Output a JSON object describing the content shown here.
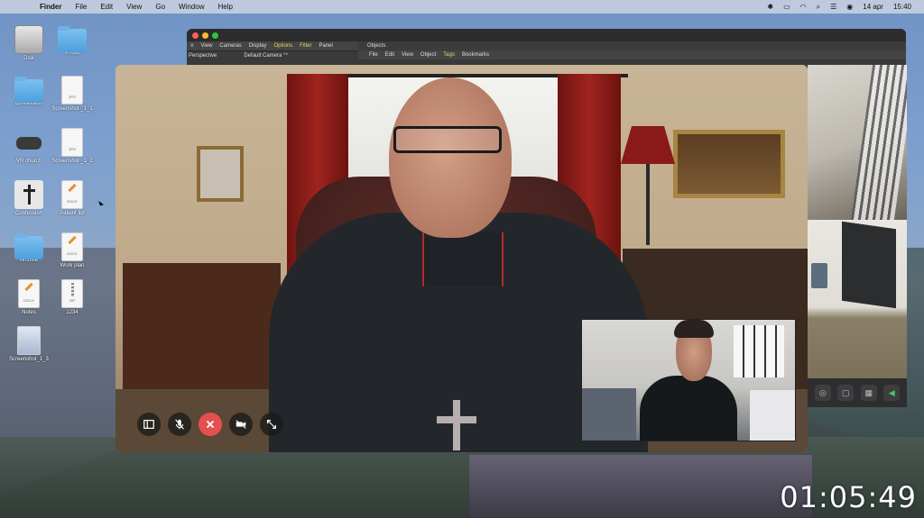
{
  "menubar": {
    "app": "Finder",
    "items": [
      "File",
      "Edit",
      "View",
      "Go",
      "Window",
      "Help"
    ],
    "date": "14 apr",
    "time": "15:40"
  },
  "desktop": {
    "icons": [
      {
        "label": "Disk",
        "type": "disk"
      },
      {
        "label": "Photo",
        "type": "folder"
      },
      {
        "label": "Confession",
        "type": "folder"
      },
      {
        "label": "Screenshot _1_1",
        "type": "doc",
        "tag": "JPG"
      },
      {
        "label": "VR church",
        "type": "vr"
      },
      {
        "label": "Screenshot _1_2",
        "type": "doc",
        "tag": "JPG"
      },
      {
        "label": "Confession",
        "type": "cross"
      },
      {
        "label": "Patient list",
        "type": "doc",
        "tag": "DOCX"
      },
      {
        "label": "Archive",
        "type": "folder"
      },
      {
        "label": "Work plan",
        "type": "doc",
        "tag": "DOCX"
      },
      {
        "label": "Notes",
        "type": "doc",
        "tag": "DOCX"
      },
      {
        "label": "1234",
        "type": "zip",
        "tag": "ZIP"
      },
      {
        "label": "Screenshot_1_3",
        "type": "shot"
      }
    ]
  },
  "app_window": {
    "toolbar1": [
      "View",
      "Cameras",
      "Display",
      "Options",
      "Filter",
      "Panel"
    ],
    "highlighted": [
      "Options",
      "Filter"
    ],
    "viewport_label": "Perspective",
    "camera_label": "Default Camera °*",
    "objects_title": "Objects",
    "objects_menu": [
      "File",
      "Edit",
      "View",
      "Object",
      "Tags",
      "Bookmarks"
    ],
    "objects_highlighted": "Tags"
  },
  "call": {
    "controls": [
      "sidebar-icon",
      "mic-icon",
      "end-call-icon",
      "camera-off-icon",
      "fullscreen-icon"
    ],
    "end_color": "#e45050"
  },
  "timer": "01:05:49"
}
